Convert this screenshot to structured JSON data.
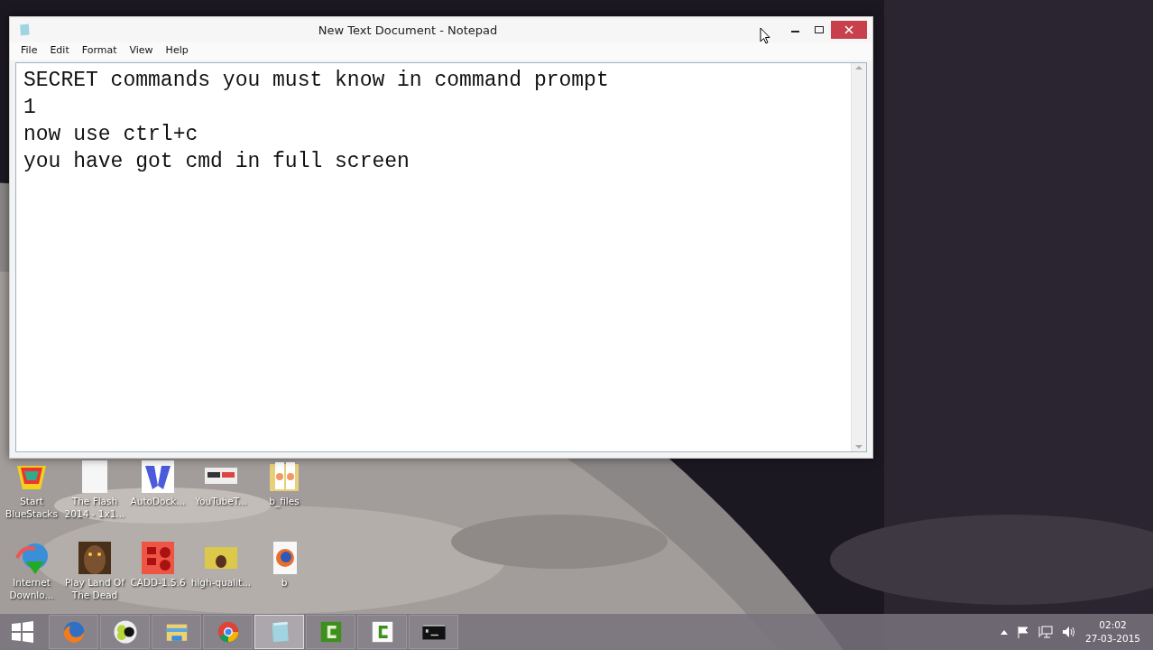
{
  "window": {
    "title": "New Text Document - Notepad"
  },
  "menu": [
    "File",
    "Edit",
    "Format",
    "View",
    "Help"
  ],
  "document": {
    "lines": [
      "SECRET commands you must know in command prompt",
      "1",
      "now use ctrl+c",
      "you have got cmd in full screen"
    ]
  },
  "desktop_icons": [
    {
      "label": "Start BlueStacks"
    },
    {
      "label": "The Flash 2014 - 1x1..."
    },
    {
      "label": "AutoDock..."
    },
    {
      "label": "YouTubeT..."
    },
    {
      "label": "b_files"
    },
    {
      "label": "Internet Downlo..."
    },
    {
      "label": "Play Land Of The Dead"
    },
    {
      "label": "CADD-1.5.6"
    },
    {
      "label": "high-qualit..."
    },
    {
      "label": "b"
    }
  ],
  "taskbar": {
    "items": [
      {
        "selected": false
      },
      {
        "selected": false
      },
      {
        "selected": false
      },
      {
        "selected": false
      },
      {
        "selected": true
      },
      {
        "selected": false
      },
      {
        "selected": false
      },
      {
        "selected": false
      }
    ],
    "time": "02:02",
    "date": "27-03-2015"
  }
}
